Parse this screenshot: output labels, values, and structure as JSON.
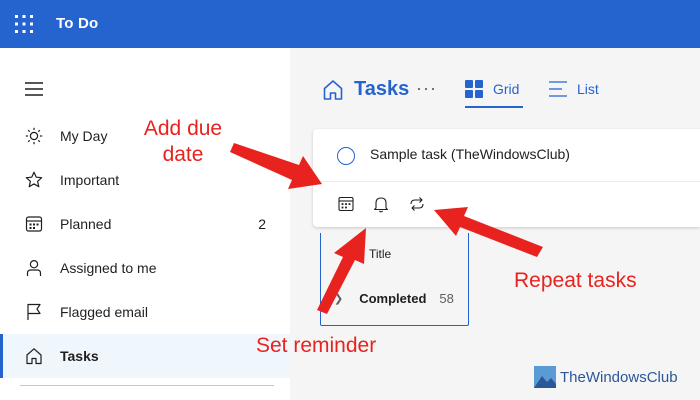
{
  "header": {
    "app_title": "To Do",
    "bg": "#2564cf"
  },
  "sidebar": {
    "items": [
      {
        "label": "My Day",
        "count": "",
        "icon": "sun-icon"
      },
      {
        "label": "Important",
        "count": "",
        "icon": "star-icon"
      },
      {
        "label": "Planned",
        "count": "2",
        "icon": "calendar-icon"
      },
      {
        "label": "Assigned to me",
        "count": "",
        "icon": "person-icon"
      },
      {
        "label": "Flagged email",
        "count": "",
        "icon": "flag-icon"
      },
      {
        "label": "Tasks",
        "count": "",
        "icon": "home-icon",
        "active": true
      }
    ]
  },
  "main": {
    "title": "Tasks",
    "more": "···",
    "views": {
      "grid": "Grid",
      "list": "List"
    },
    "task_input_value": "Sample task (TheWindowsClub)",
    "column_title": "Title",
    "completed_label": "Completed",
    "completed_count": "58"
  },
  "annotations": {
    "add_due_date": "Add due date",
    "repeat_tasks": "Repeat tasks",
    "set_reminder": "Set reminder",
    "color": "#e8231f"
  },
  "watermark": "TheWindowsClub",
  "colors": {
    "accent": "#2564cf",
    "main_bg": "#f5f5f5"
  }
}
